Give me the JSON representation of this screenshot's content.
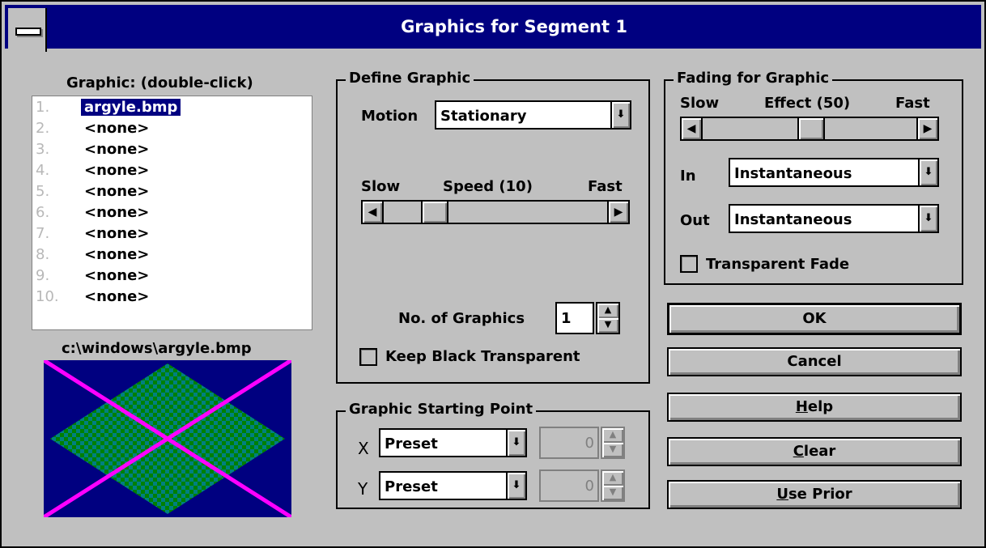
{
  "window": {
    "title": "Graphics for Segment 1"
  },
  "graphic_list": {
    "label": "Graphic: (double-click)",
    "items": [
      {
        "num": "1.",
        "name": "argyle.bmp",
        "selected": true
      },
      {
        "num": "2.",
        "name": "<none>"
      },
      {
        "num": "3.",
        "name": "<none>"
      },
      {
        "num": "4.",
        "name": "<none>"
      },
      {
        "num": "5.",
        "name": "<none>"
      },
      {
        "num": "6.",
        "name": "<none>"
      },
      {
        "num": "7.",
        "name": "<none>"
      },
      {
        "num": "8.",
        "name": "<none>"
      },
      {
        "num": "9.",
        "name": "<none>"
      },
      {
        "num": "10.",
        "name": "<none>"
      }
    ],
    "preview_path": "c:\\windows\\argyle.bmp"
  },
  "define_graphic": {
    "title": "Define Graphic",
    "motion_label": "Motion",
    "motion_value": "Stationary",
    "speed": {
      "slow": "Slow",
      "label": "Speed (10)",
      "fast": "Fast",
      "value": 10
    },
    "num_graphics_label": "No. of Graphics",
    "num_graphics_value": "1",
    "keep_black_label": "Keep Black Transparent"
  },
  "starting_point": {
    "title": "Graphic Starting Point",
    "x_label": "X",
    "x_mode": "Preset",
    "x_value": "0",
    "y_label": "Y",
    "y_mode": "Preset",
    "y_value": "0"
  },
  "fading": {
    "title": "Fading for Graphic",
    "slow": "Slow",
    "effect_label": "Effect (50)",
    "fast": "Fast",
    "effect_value": 50,
    "in_label": "In",
    "in_value": "Instantaneous",
    "out_label": "Out",
    "out_value": "Instantaneous",
    "transparent_fade_label": "Transparent Fade"
  },
  "buttons": {
    "ok": "OK",
    "cancel": "Cancel",
    "help_mn": "H",
    "help_rest": "elp",
    "clear_mn": "C",
    "clear_rest": "lear",
    "prior_mn": "U",
    "prior_rest": "se Prior"
  },
  "colors": {
    "title_bar": "#000080",
    "face": "#c0c0c0",
    "preview_bg": "#000080",
    "preview_teal": "#008080",
    "preview_green": "#008000",
    "preview_lines": "#ff00ff"
  }
}
